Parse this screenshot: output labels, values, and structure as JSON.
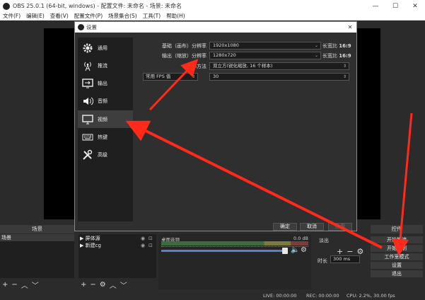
{
  "window": {
    "title": "OBS 25.0.1 (64-bit, windows) - 配置文件: 未命名 - 场景: 未命名",
    "minimize": "—",
    "maximize": "☐",
    "close": "✕"
  },
  "menubar": [
    "文件(F)",
    "编辑(E)",
    "查看(V)",
    "配置文件(P)",
    "场景集合(S)",
    "工具(T)",
    "帮助(H)"
  ],
  "docks": {
    "scenes": {
      "header": "场景",
      "items": [
        "场景"
      ]
    },
    "sources": {
      "items": [
        "▶ 屏体源",
        "▶ 新建cg"
      ]
    },
    "mixer": {
      "title": "桌面音频",
      "db": "0.0 dB"
    },
    "transitions": {
      "label": "淡出",
      "duration_label": "时长",
      "duration_value": "300 ms"
    },
    "controls": {
      "header": "控件",
      "buttons": [
        "开始推流",
        "开始录制",
        "工作室模式",
        "设置",
        "退出"
      ]
    }
  },
  "statusbar": {
    "live": "LIVE: 00:00:00",
    "rec": "REC: 00:00:00",
    "cpu": "CPU: 2.2%, 30.00 fps"
  },
  "dialog": {
    "title": "设置",
    "close": "✕",
    "sidebar": [
      {
        "label": "通用",
        "icon": "gear-icon"
      },
      {
        "label": "推流",
        "icon": "broadcast-icon"
      },
      {
        "label": "输出",
        "icon": "output-icon"
      },
      {
        "label": "音频",
        "icon": "speaker-icon"
      },
      {
        "label": "视频",
        "icon": "monitor-icon"
      },
      {
        "label": "热键",
        "icon": "keyboard-icon"
      },
      {
        "label": "高级",
        "icon": "tools-icon"
      }
    ],
    "active_index": 4,
    "form": {
      "base_label": "基础（画布）分辨率",
      "base_value": "1920x1080",
      "base_ratio_label": "长宽比",
      "base_ratio": "16:9",
      "output_label": "输出（缩放）分辨率",
      "output_value": "1280x720",
      "output_ratio_label": "长宽比",
      "output_ratio": "16:9",
      "downscale_label": "缩小方法",
      "downscale_value": "双立方(锐化缩放, 16 个样本)",
      "fps_type": "常用 FPS 值",
      "fps_value": "30"
    },
    "buttons": {
      "ok": "确定",
      "cancel": "取消",
      "apply": "应用"
    }
  },
  "colors": {
    "accent": "#5a7fcf",
    "arrow": "#ff2a1a",
    "panel": "#2b2b2b"
  }
}
